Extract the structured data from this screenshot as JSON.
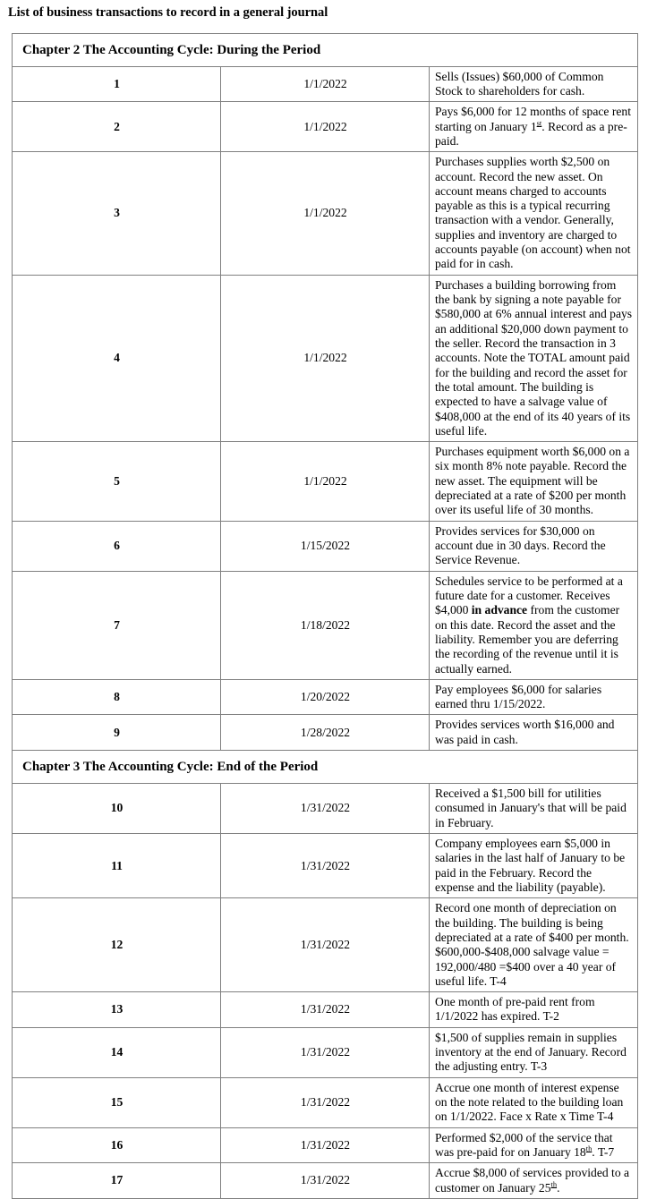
{
  "document": {
    "title": "List of business transactions to record in a general journal"
  },
  "table": {
    "sections": [
      {
        "heading": "Chapter 2 The Accounting Cycle: During the Period",
        "rows": [
          {
            "num": "1",
            "date": "1/1/2022",
            "description": "Sells (Issues) $60,000 of Common Stock to shareholders for cash."
          },
          {
            "num": "2",
            "date": "1/1/2022",
            "description": "Pays $6,000 for 12 months of space rent starting on January 1st. Record as a pre-paid.",
            "html": "Pays $6,000 for 12 months of space rent starting on January 1<sup>st</sup>. Record as a pre-paid."
          },
          {
            "num": "3",
            "date": "1/1/2022",
            "description": "Purchases supplies worth $2,500 on account. Record the new asset. On account means charged to accounts payable as this is a typical recurring transaction with a vendor.  Generally, supplies and inventory are charged to accounts payable (on account) when not paid for in cash."
          },
          {
            "num": "4",
            "date": "1/1/2022",
            "description": "Purchases a building borrowing from the bank by signing a note payable for $580,000 at 6% annual interest and pays an additional $20,000 down payment to the seller. Record the transaction in 3 accounts. Note the TOTAL amount paid for the building and record the asset for the total amount. The building is expected to have a salvage value of  $408,000 at the end of its 40 years of its useful life."
          },
          {
            "num": "5",
            "date": "1/1/2022",
            "description": "Purchases equipment worth $6,000 on a six month 8% note payable. Record the new asset. The equipment will be depreciated at a rate of $200 per month over its useful life of 30 months."
          },
          {
            "num": "6",
            "date": "1/15/2022",
            "description": "Provides services for $30,000 on account due in 30 days.  Record the Service Revenue."
          },
          {
            "num": "7",
            "date": "1/18/2022",
            "description": "Schedules service to be performed at a future date for a customer. Receives $4,000 in advance from the customer on this date. Record the asset and the liability. Remember you are deferring the recording of the revenue until it is actually earned.",
            "html": "Schedules service to be performed at a future date for a customer. Receives $4,000 <b class=\"inline-bold\">in advance</b> from the customer on this date. Record the asset and the liability. Remember you are deferring the recording of the revenue until it is actually earned."
          },
          {
            "num": "8",
            "date": "1/20/2022",
            "description": "Pay employees $6,000 for salaries earned thru 1/15/2022."
          },
          {
            "num": "9",
            "date": "1/28/2022",
            "description": "Provides services worth $16,000 and was paid in cash."
          }
        ]
      },
      {
        "heading": "Chapter 3 The Accounting Cycle: End of the Period",
        "rows": [
          {
            "num": "10",
            "date": "1/31/2022",
            "description": "Received a $1,500 bill for utilities consumed in January's that will be paid in February."
          },
          {
            "num": "11",
            "date": "1/31/2022",
            "description": "Company employees earn $5,000 in salaries in the last half of January to be paid in the February. Record the expense and the liability (payable)."
          },
          {
            "num": "12",
            "date": "1/31/2022",
            "description": "Record one month of depreciation on the building. The building is being depreciated at a rate of $400 per month.  $600,000-$408,000 salvage value = 192,000/480 =$400 over a 40 year of useful life. T-4"
          },
          {
            "num": "13",
            "date": "1/31/2022",
            "description": "One month of pre-paid rent from 1/1/2022 has expired. T-2"
          },
          {
            "num": "14",
            "date": "1/31/2022",
            "description": "$1,500 of supplies remain in supplies inventory at the end of January. Record the adjusting entry. T-3"
          },
          {
            "num": "15",
            "date": "1/31/2022",
            "description": "Accrue one month of interest expense on the note related to the building loan on 1/1/2022. Face x Rate x Time  T-4"
          },
          {
            "num": "16",
            "date": "1/31/2022",
            "description": "Performed $2,000 of the service that was pre-paid for on January 18th.  T-7",
            "html": "Performed $2,000 of the service that was pre-paid for on January 18<sup>th</sup>.  T-7"
          },
          {
            "num": "17",
            "date": "1/31/2022",
            "description": "Accrue $8,000 of services provided to a customer on January 25th.",
            "html": "Accrue $8,000 of services provided to a customer on January 25<sup>th</sup>."
          }
        ]
      }
    ]
  }
}
